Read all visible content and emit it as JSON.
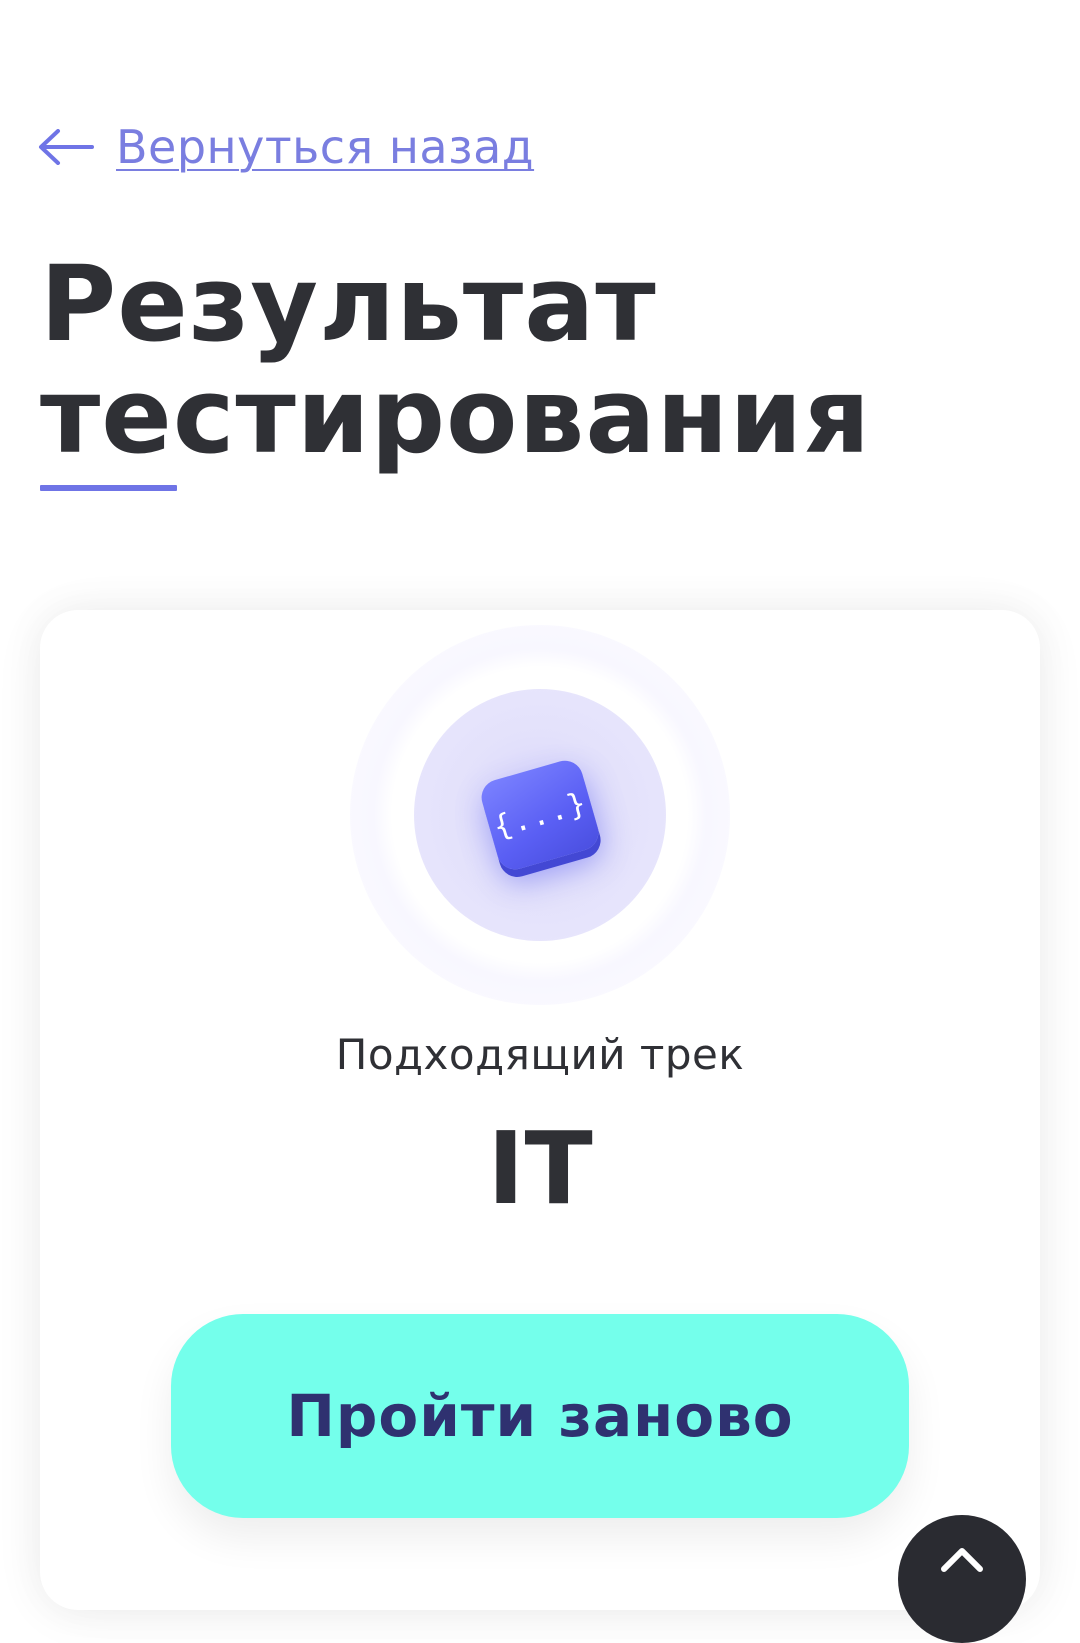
{
  "nav": {
    "back_label": "Вернуться назад",
    "back_icon": "arrow-left-icon"
  },
  "header": {
    "title_line1": "Результат",
    "title_line2": "тестирования"
  },
  "result": {
    "icon": "code-braces-icon",
    "icon_glyph": "{...}",
    "caption": "Подходящий трек",
    "track": "IT",
    "retry_label": "Пройти заново"
  },
  "floating": {
    "scroll_top_icon": "chevron-up-icon"
  },
  "colors": {
    "accent": "#6f74e6",
    "button": "#74ffeb",
    "button_text": "#2f3170",
    "text": "#2f3035",
    "badge": "#5a5ff4"
  }
}
